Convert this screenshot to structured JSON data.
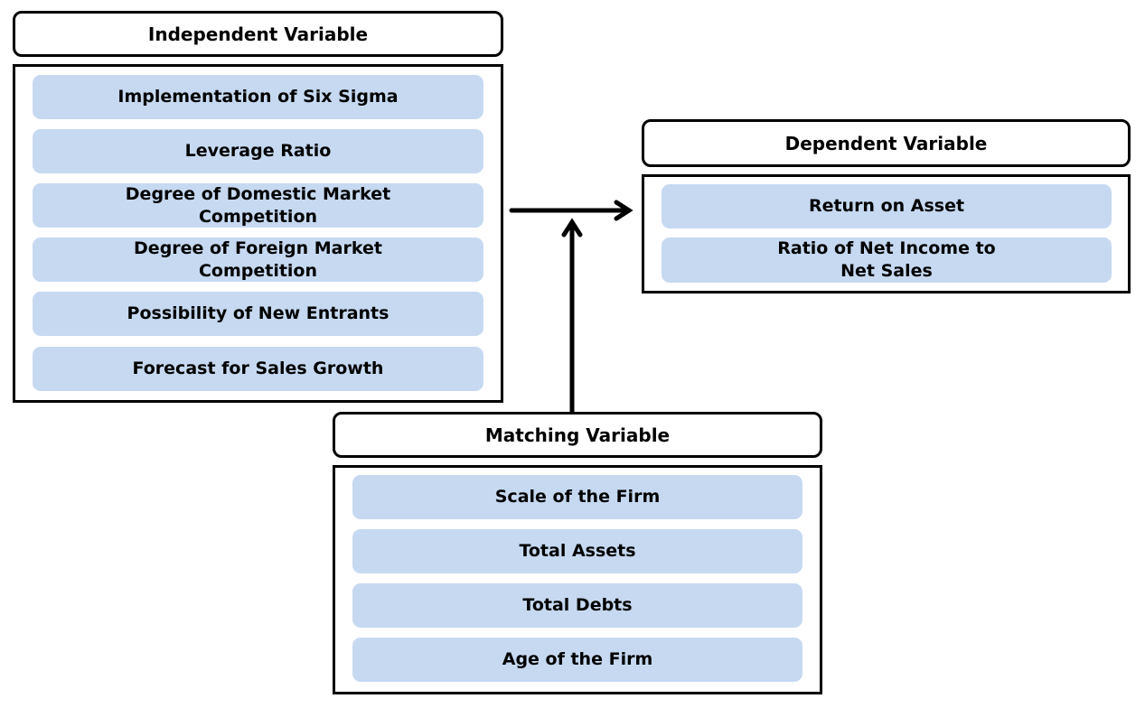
{
  "independent": {
    "title": "Independent Variable",
    "items": [
      "Implementation of Six Sigma",
      "Leverage Ratio",
      "Degree of Domestic Market\nCompetition",
      "Degree of Foreign Market\nCompetition",
      "Possibility of New Entrants",
      "Forecast for Sales Growth"
    ]
  },
  "dependent": {
    "title": "Dependent Variable",
    "items": [
      "Return on Asset",
      "Ratio of Net Income to\nNet Sales"
    ]
  },
  "matching": {
    "title": "Matching Variable",
    "items": [
      "Scale of the Firm",
      "Total Assets",
      "Total Debts",
      "Age of the Firm"
    ]
  },
  "colors": {
    "item_fill": "#c6d9f1",
    "border": "#000000"
  }
}
